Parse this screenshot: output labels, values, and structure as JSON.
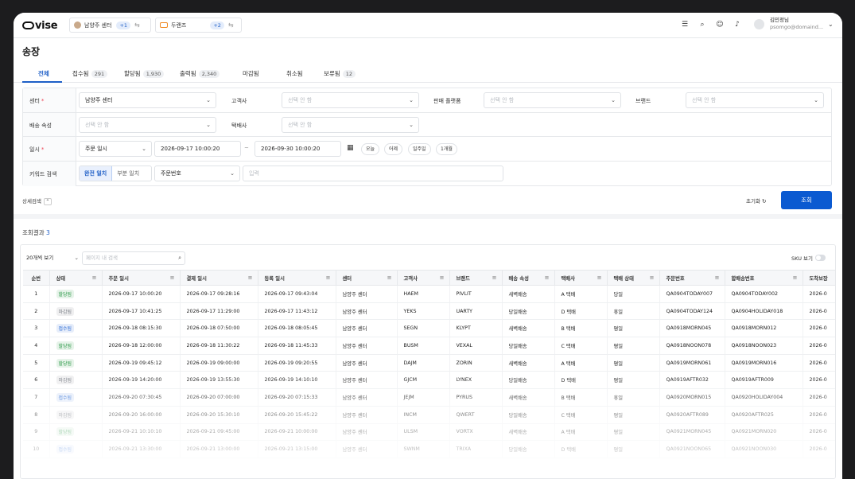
{
  "header": {
    "logo": "vise",
    "center_ctx": "남양주 센터",
    "center_more": "+1",
    "brand_ctx": "두랜즈",
    "brand_more": "+2",
    "user_name": "김민정님",
    "user_email": "psomgo@domaind..."
  },
  "page": {
    "title": "송장"
  },
  "tabs": [
    {
      "label": "전체",
      "count": ""
    },
    {
      "label": "접수됨",
      "count": "291"
    },
    {
      "label": "할당됨",
      "count": "1,930"
    },
    {
      "label": "출력됨",
      "count": "2,340"
    },
    {
      "label": "마감됨",
      "count": ""
    },
    {
      "label": "취소됨",
      "count": ""
    },
    {
      "label": "보류됨",
      "count": "12"
    }
  ],
  "filters": {
    "center_label": "센터",
    "center_value": "남양주 센터",
    "customer_label": "고객사",
    "customer_ph": "선택 안 함",
    "platform_label": "판매 플랫폼",
    "platform_ph": "선택 안 함",
    "brand_label": "브랜드",
    "brand_ph": "선택 안 함",
    "delivery_attr_label": "배송 속성",
    "delivery_attr_ph": "선택 안 함",
    "courier_label": "택배사",
    "courier_ph": "선택 안 함",
    "date_label": "일시",
    "date_type": "주문 일시",
    "date_from": "2026-09-17 10:00:20",
    "date_sep": "~",
    "date_to": "2026-09-30 10:00:20",
    "quick": [
      "오늘",
      "어제",
      "일주일",
      "1개월"
    ],
    "keyword_label": "키워드 검색",
    "match_exact": "완전 일치",
    "match_partial": "부분 일치",
    "keyword_field": "주문번호",
    "keyword_ph": "입력"
  },
  "actions": {
    "detail": "상세검색",
    "reset": "초기화",
    "search": "조회"
  },
  "results": {
    "label": "조회결과",
    "count": "3",
    "page_size": "20개씩 보기",
    "page_search_ph": "페이지 내 검색",
    "sku_toggle": "SKU 보기"
  },
  "table": {
    "columns": [
      "순번",
      "상태",
      "주문 일시",
      "결제 일시",
      "등록 일시",
      "센터",
      "고객사",
      "브랜드",
      "배송 속성",
      "택배사",
      "택배 상태",
      "주문번호",
      "합배송번호",
      "도착보장"
    ],
    "rows": [
      [
        "1",
        "할당됨",
        "2026-09-17 10:00:20",
        "2026-09-17 09:28:16",
        "2026-09-17 09:43:04",
        "남양주 센터",
        "HAEM",
        "PIVLIT",
        "새벽배송",
        "A 택배",
        "당일",
        "QA0904TODAY007",
        "QA0904TODAY002",
        "2026-0"
      ],
      [
        "2",
        "마감됨",
        "2026-09-17 10:41:25",
        "2026-09-17 11:29:00",
        "2026-09-17 11:43:12",
        "남양주 센터",
        "YEKS",
        "UARTY",
        "당일배송",
        "D 택배",
        "휴일",
        "QA0904TODAY124",
        "QA0904HOLIDAY018",
        "2026-0"
      ],
      [
        "3",
        "접수됨",
        "2026-09-18 08:15:30",
        "2026-09-18 07:50:00",
        "2026-09-18 08:05:45",
        "남양주 센터",
        "SEGN",
        "KLYPT",
        "새벽배송",
        "B 택배",
        "평일",
        "QA0918MORN045",
        "QA0918MORN012",
        "2026-0"
      ],
      [
        "4",
        "할당됨",
        "2026-09-18 12:00:00",
        "2026-09-18 11:30:22",
        "2026-09-18 11:45:33",
        "남양주 센터",
        "BUSM",
        "VEXAL",
        "당일배송",
        "C 택배",
        "평일",
        "QA0918NOON078",
        "QA0918NOON023",
        "2026-0"
      ],
      [
        "5",
        "할당됨",
        "2026-09-19 09:45:12",
        "2026-09-19 09:00:00",
        "2026-09-19 09:20:55",
        "남양주 센터",
        "DAJM",
        "ZORIN",
        "새벽배송",
        "A 택배",
        "평일",
        "QA0919MORN061",
        "QA0919MORN016",
        "2026-0"
      ],
      [
        "6",
        "마감됨",
        "2026-09-19 14:20:00",
        "2026-09-19 13:55:30",
        "2026-09-19 14:10:10",
        "남양주 센터",
        "GJCM",
        "LYNEX",
        "당일배송",
        "D 택배",
        "평일",
        "QA0919AFTR032",
        "QA0919AFTR009",
        "2026-0"
      ],
      [
        "7",
        "접수됨",
        "2026-09-20 07:30:45",
        "2026-09-20 07:00:00",
        "2026-09-20 07:15:33",
        "남양주 센터",
        "JEJM",
        "PYRUS",
        "새벽배송",
        "B 택배",
        "휴일",
        "QA0920MORN015",
        "QA0920HOLIDAY004",
        "2026-0"
      ],
      [
        "8",
        "마감됨",
        "2026-09-20 16:00:00",
        "2026-09-20 15:30:10",
        "2026-09-20 15:45:22",
        "남양주 센터",
        "INCM",
        "QWERT",
        "당일배송",
        "C 택배",
        "평일",
        "QA0920AFTR089",
        "QA0920AFTR025",
        "2026-0"
      ],
      [
        "9",
        "할당됨",
        "2026-09-21 10:10:10",
        "2026-09-21 09:45:00",
        "2026-09-21 10:00:00",
        "남양주 센터",
        "ULSM",
        "VORTX",
        "새벽배송",
        "A 택배",
        "평일",
        "QA0921MORN045",
        "QA0921MORN020",
        "2026-0"
      ],
      [
        "10",
        "접수됨",
        "2026-09-21 13:30:00",
        "2026-09-21 13:00:00",
        "2026-09-21 13:15:00",
        "남양주 센터",
        "SWNM",
        "TRIXA",
        "당일배송",
        "D 택배",
        "평일",
        "QA0921NOON065",
        "QA0921NOON030",
        "2026-0"
      ]
    ]
  },
  "status_colors": {
    "할당됨": "#2e9a4a",
    "마감됨": "#7a7f87",
    "접수됨": "#2f6fd6"
  }
}
